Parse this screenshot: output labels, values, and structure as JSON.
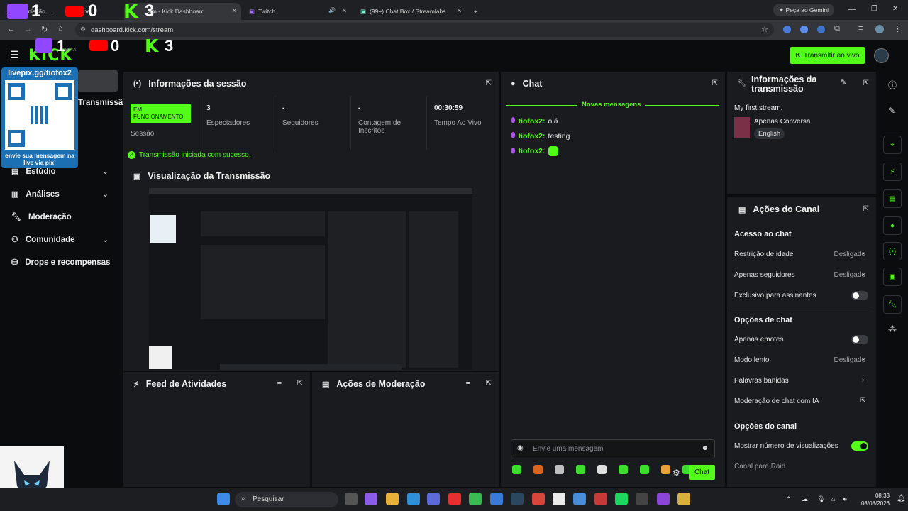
{
  "browser": {
    "tabs": [
      {
        "label": "nsmissão ...",
        "icon": "twitch-icon"
      },
      {
        "label": "Tube",
        "icon": "youtube-icon"
      },
      {
        "label": "am - Kick Dashboard",
        "icon": "kick-icon"
      },
      {
        "label": "Twitch",
        "icon": "twitch-icon"
      },
      {
        "label": "(99+) Chat Box / Streamlabs",
        "icon": "streamlabs-icon"
      }
    ],
    "gemini_label": "Peça ao Gemini",
    "url": "dashboard.kick.com/stream"
  },
  "overlay": {
    "twitch_count": "1",
    "youtube_count": "0",
    "kick_count": "3",
    "livepix_title": "livepix.gg/tiofox2",
    "livepix_caption": "envie sua mensagem na live via pix!"
  },
  "header": {
    "logo": "KICK",
    "logo_tag": "BETA",
    "live_button": "Transmitir ao vivo"
  },
  "nav": {
    "truncated_item": "Transmissã",
    "items": [
      {
        "label": "Estúdio",
        "icon": "studio-icon"
      },
      {
        "label": "Análises",
        "icon": "analytics-icon"
      },
      {
        "label": "Moderação",
        "icon": "wrench-icon"
      },
      {
        "label": "Comunidade",
        "icon": "community-icon"
      },
      {
        "label": "Drops e recompensas",
        "icon": "drops-icon"
      }
    ]
  },
  "session": {
    "title": "Informações da sessão",
    "status_badge": "EM FUNCIONAMENTO",
    "status_label": "Sessão",
    "viewers_value": "3",
    "viewers_label": "Espectadores",
    "followers_value": "-",
    "followers_label": "Seguidores",
    "subs_value": "-",
    "subs_label": "Contagem de Inscritos",
    "time_value": "00:30:59",
    "time_label": "Tempo Ao Vivo",
    "success_msg": "Transmissão iniciada com sucesso."
  },
  "preview": {
    "title": "Visualização da Transmissão"
  },
  "feed": {
    "title": "Feed de Atividades"
  },
  "modactions": {
    "title": "Ações de Moderação"
  },
  "chat": {
    "title": "Chat",
    "new_messages": "Novas mensagens",
    "messages": [
      {
        "user": "tiofox2:",
        "text": "olá"
      },
      {
        "user": "tiofox2:",
        "text": "testing"
      },
      {
        "user": "tiofox2:",
        "text": ""
      }
    ],
    "input_placeholder": "Envie uma mensagem",
    "send_button": "Chat"
  },
  "stream_info": {
    "title": "Informações da transmissão",
    "stream_title": "My first stream.",
    "category": "Apenas Conversa",
    "language": "English"
  },
  "channel_actions": {
    "title": "Ações do Canal",
    "chat_access_heading": "Acesso ao chat",
    "age_restriction": "Restrição de idade",
    "age_restriction_value": "Desligado",
    "followers_only": "Apenas seguidores",
    "followers_only_value": "Desligado",
    "subs_only": "Exclusivo para assinantes",
    "chat_options_heading": "Opções de chat",
    "emotes_only": "Apenas emotes",
    "slow_mode": "Modo lento",
    "slow_mode_value": "Desligado",
    "banned_words": "Palavras banidas",
    "ai_moderation": "Moderação de chat com IA",
    "channel_options_heading": "Opções do canal",
    "show_views": "Mostrar número de visualizações",
    "raid_channel": "Canal para Raid"
  },
  "taskbar": {
    "search": "Pesquisar",
    "time": "08:33",
    "date": "08/08/2026"
  },
  "colors": {
    "kick_green": "#53fc18",
    "panel": "#191b1f",
    "bg": "#0b0c0d"
  }
}
